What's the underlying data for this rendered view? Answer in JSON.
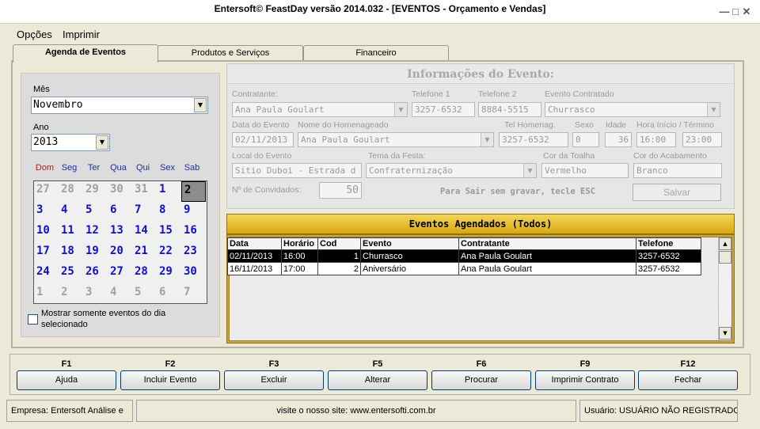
{
  "window": {
    "title": "Entersoft© FeastDay versão 2014.032 - [EVENTOS - Orçamento e Vendas]"
  },
  "menu": {
    "options": "Opções",
    "print": "Imprimir"
  },
  "tabs": [
    {
      "label": "Agenda de Eventos"
    },
    {
      "label": "Produtos e Serviços"
    },
    {
      "label": "Financeiro"
    }
  ],
  "calendar": {
    "month_label": "Mês",
    "month_value": "Novembro",
    "year_label": "Ano",
    "year_value": "2013",
    "weekdays": [
      "Dom",
      "Seg",
      "Ter",
      "Qua",
      "Qui",
      "Sex",
      "Sab"
    ],
    "days": [
      {
        "d": "27",
        "muted": true
      },
      {
        "d": "28",
        "muted": true
      },
      {
        "d": "29",
        "muted": true
      },
      {
        "d": "30",
        "muted": true
      },
      {
        "d": "31",
        "muted": true
      },
      {
        "d": "1"
      },
      {
        "d": "2",
        "selected": true
      },
      {
        "d": "3"
      },
      {
        "d": "4"
      },
      {
        "d": "5"
      },
      {
        "d": "6"
      },
      {
        "d": "7"
      },
      {
        "d": "8"
      },
      {
        "d": "9"
      },
      {
        "d": "10"
      },
      {
        "d": "11"
      },
      {
        "d": "12"
      },
      {
        "d": "13"
      },
      {
        "d": "14"
      },
      {
        "d": "15"
      },
      {
        "d": "16"
      },
      {
        "d": "17"
      },
      {
        "d": "18"
      },
      {
        "d": "19"
      },
      {
        "d": "20"
      },
      {
        "d": "21"
      },
      {
        "d": "22"
      },
      {
        "d": "23"
      },
      {
        "d": "24"
      },
      {
        "d": "25"
      },
      {
        "d": "26"
      },
      {
        "d": "27"
      },
      {
        "d": "28"
      },
      {
        "d": "29"
      },
      {
        "d": "30"
      },
      {
        "d": "1",
        "muted": true
      },
      {
        "d": "2",
        "muted": true
      },
      {
        "d": "3",
        "muted": true
      },
      {
        "d": "4",
        "muted": true
      },
      {
        "d": "5",
        "muted": true
      },
      {
        "d": "6",
        "muted": true
      },
      {
        "d": "7",
        "muted": true
      }
    ],
    "checkbox_label_1": "Mostrar somente eventos do dia",
    "checkbox_label_2": "selecionado",
    "checkbox_checked": false
  },
  "info": {
    "title": "Informações do Evento:",
    "contratante_label": "Contratante:",
    "contratante_value": "Ana Paula Goulart",
    "telefone1_label": "Telefone 1",
    "telefone1_value": "3257-6532",
    "telefone2_label": "Telefone 2",
    "telefone2_value": "8884-5515",
    "evento_contratado_label": "Evento Contratado",
    "evento_contratado_value": "Churrasco",
    "data_label": "Data do Evento",
    "data_value": "02/11/2013",
    "homenageado_label": "Nome do Homenageado",
    "homenageado_value": "Ana Paula Goulart",
    "tel_homenag_label": "Tel Homenag.",
    "tel_homenag_value": "3257-6532",
    "sexo_label": "Sexo",
    "sexo_value": "0",
    "idade_label": "Idade",
    "idade_value": "36",
    "horario_label": "Hora Início / Término",
    "hora_inicio_value": "16:00",
    "hora_termino_value": "23:00",
    "local_label": "Local do Evento",
    "local_value": "Sítio Duboi - Estrada d",
    "tema_label": "Tema da Festa:",
    "tema_value": "Confraternização",
    "cor_toalha_label": "Cor da Toalha",
    "cor_toalha_value": "Vermelho",
    "cor_acabamento_label": "Cor do Acabamento",
    "cor_acabamento_value": "Branco",
    "convidados_label": "Nº de Convidados:",
    "convidados_value": "50",
    "esc_hint": "Para Sair sem gravar, tecle ESC",
    "save_label": "Salvar"
  },
  "events": {
    "header": "Eventos Agendados (Todos)",
    "columns": [
      "Data",
      "Horário",
      "Cod",
      "Evento",
      "Contratante",
      "Telefone"
    ],
    "rows": [
      {
        "data": "02/11/2013",
        "horario": "16:00",
        "cod": "1",
        "evento": "Churrasco",
        "contratante": "Ana Paula Goulart",
        "telefone": "3257-6532",
        "selected": true
      },
      {
        "data": "16/11/2013",
        "horario": "17:00",
        "cod": "2",
        "evento": "Aniversário",
        "contratante": "Ana Paula Goulart",
        "telefone": "3257-6532",
        "selected": false
      }
    ]
  },
  "function_keys": [
    {
      "key": "F1",
      "label": "Ajuda"
    },
    {
      "key": "F2",
      "label": "Incluir Evento"
    },
    {
      "key": "F3",
      "label": "Excluir"
    },
    {
      "key": "F5",
      "label": "Alterar"
    },
    {
      "key": "F6",
      "label": "Procurar"
    },
    {
      "key": "F9",
      "label": "Imprimir Contrato"
    },
    {
      "key": "F12",
      "label": "Fechar"
    }
  ],
  "status": {
    "empresa": "Empresa: Entersoft Análise e",
    "site": "visite o nosso site: www.entersofti.com.br",
    "usuario": "Usuário: USUÁRIO NÃO REGISTRADO"
  }
}
